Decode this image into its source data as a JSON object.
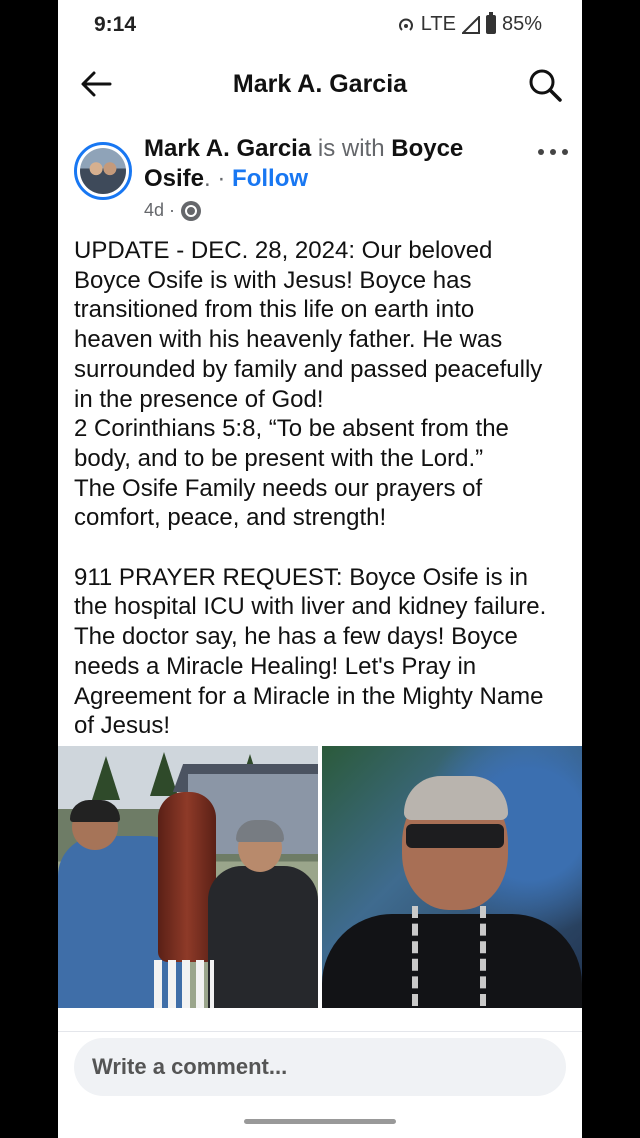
{
  "status_bar": {
    "time": "9:14",
    "network": "LTE",
    "battery": "85%"
  },
  "header": {
    "title": "Mark A. Garcia"
  },
  "post": {
    "author": "Mark A. Garcia",
    "with_text": "is with",
    "tagged": "Boyce Osife",
    "tagged_suffix": ".",
    "separator": " · ",
    "follow_label": "Follow",
    "age": "4d ·",
    "body": "UPDATE - DEC. 28, 2024: Our beloved Boyce Osife is with Jesus! Boyce has transitioned from this life on earth into heaven with his heavenly father. He was surrounded by family and passed peacefully in the presence of God!\n2 Corinthians 5:8, “To be absent from the body, and to be present with the Lord.”\nThe Osife Family needs our prayers of comfort, peace, and strength!\n\n911 PRAYER REQUEST: Boyce Osife is in the hospital ICU with liver and kidney failure. The doctor say, he has a few days! Boyce needs a Miracle Healing! Let's Pray in Agreement for a Miracle in the Mighty Name of Jesus!"
  },
  "comment": {
    "placeholder": "Write a comment..."
  },
  "icons": [
    "back-arrow-icon",
    "search-icon",
    "more-options-icon",
    "globe-icon",
    "hotspot-icon",
    "signal-icon",
    "battery-icon"
  ],
  "colors": {
    "accent": "#1877f2",
    "secondary_text": "#65676b",
    "comment_bg": "#f0f2f5"
  }
}
